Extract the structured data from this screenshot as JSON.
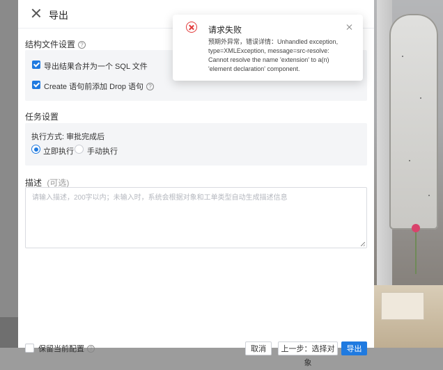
{
  "dialog": {
    "title": "导出",
    "structure_section": "结构文件设置",
    "help_glyph": "?",
    "options": [
      {
        "label": "导出结果合并为一个 SQL 文件",
        "checked": true
      },
      {
        "label": "Create 语句前添加 Drop 语句",
        "checked": true
      }
    ],
    "task_section": "任务设置",
    "exec_label": "执行方式: 审批完成后",
    "exec_options": [
      {
        "label": "立即执行",
        "selected": true
      },
      {
        "label": "手动执行",
        "selected": false
      }
    ],
    "desc_label": "描述",
    "desc_optional": "(可选)",
    "desc_placeholder": "请输入描述，200字以内；未输入时，系统会根据对象和工单类型自动生成描述信息"
  },
  "footer": {
    "save_config_label": "保留当前配置",
    "cancel_label": "取消",
    "prev_label": "上一步：选择对象",
    "export_label": "导出"
  },
  "notification": {
    "title": "请求失败",
    "message": "预期外异常，错误详情：Unhandled exception, type=XMLException, message=src-resolve: Cannot resolve the name 'extension' to a(n) 'element declaration' component."
  },
  "colors": {
    "primary": "#1f7ae0",
    "error": "#e23b3b",
    "panel_bg": "#f4f5f7"
  }
}
